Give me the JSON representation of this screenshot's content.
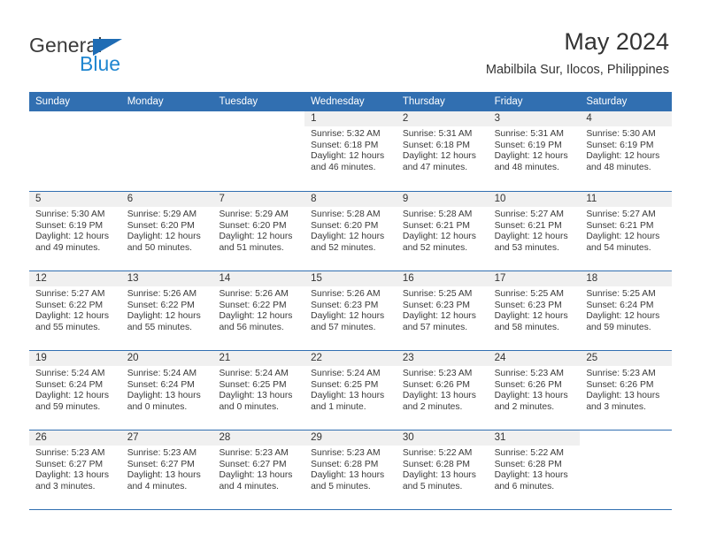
{
  "brand": {
    "name_top": "General",
    "name_bottom": "Blue",
    "accent_color": "#1f86d0",
    "triangle_color": "#1f6cb4"
  },
  "header": {
    "title": "May 2024",
    "subtitle": "Mabilbila Sur, Ilocos, Philippines"
  },
  "calendar": {
    "header_bg": "#316fb1",
    "day_band_bg": "#f0f0f0",
    "weekdays": [
      "Sunday",
      "Monday",
      "Tuesday",
      "Wednesday",
      "Thursday",
      "Friday",
      "Saturday"
    ],
    "weeks": [
      [
        {
          "day": "",
          "blank": true,
          "sunrise": "",
          "sunset": "",
          "daylight_1": "",
          "daylight_2": ""
        },
        {
          "day": "",
          "blank": true,
          "sunrise": "",
          "sunset": "",
          "daylight_1": "",
          "daylight_2": ""
        },
        {
          "day": "",
          "blank": true,
          "sunrise": "",
          "sunset": "",
          "daylight_1": "",
          "daylight_2": ""
        },
        {
          "day": "1",
          "sunrise": "Sunrise: 5:32 AM",
          "sunset": "Sunset: 6:18 PM",
          "daylight_1": "Daylight: 12 hours",
          "daylight_2": "and 46 minutes."
        },
        {
          "day": "2",
          "sunrise": "Sunrise: 5:31 AM",
          "sunset": "Sunset: 6:18 PM",
          "daylight_1": "Daylight: 12 hours",
          "daylight_2": "and 47 minutes."
        },
        {
          "day": "3",
          "sunrise": "Sunrise: 5:31 AM",
          "sunset": "Sunset: 6:19 PM",
          "daylight_1": "Daylight: 12 hours",
          "daylight_2": "and 48 minutes."
        },
        {
          "day": "4",
          "sunrise": "Sunrise: 5:30 AM",
          "sunset": "Sunset: 6:19 PM",
          "daylight_1": "Daylight: 12 hours",
          "daylight_2": "and 48 minutes."
        }
      ],
      [
        {
          "day": "5",
          "sunrise": "Sunrise: 5:30 AM",
          "sunset": "Sunset: 6:19 PM",
          "daylight_1": "Daylight: 12 hours",
          "daylight_2": "and 49 minutes."
        },
        {
          "day": "6",
          "sunrise": "Sunrise: 5:29 AM",
          "sunset": "Sunset: 6:20 PM",
          "daylight_1": "Daylight: 12 hours",
          "daylight_2": "and 50 minutes."
        },
        {
          "day": "7",
          "sunrise": "Sunrise: 5:29 AM",
          "sunset": "Sunset: 6:20 PM",
          "daylight_1": "Daylight: 12 hours",
          "daylight_2": "and 51 minutes."
        },
        {
          "day": "8",
          "sunrise": "Sunrise: 5:28 AM",
          "sunset": "Sunset: 6:20 PM",
          "daylight_1": "Daylight: 12 hours",
          "daylight_2": "and 52 minutes."
        },
        {
          "day": "9",
          "sunrise": "Sunrise: 5:28 AM",
          "sunset": "Sunset: 6:21 PM",
          "daylight_1": "Daylight: 12 hours",
          "daylight_2": "and 52 minutes."
        },
        {
          "day": "10",
          "sunrise": "Sunrise: 5:27 AM",
          "sunset": "Sunset: 6:21 PM",
          "daylight_1": "Daylight: 12 hours",
          "daylight_2": "and 53 minutes."
        },
        {
          "day": "11",
          "sunrise": "Sunrise: 5:27 AM",
          "sunset": "Sunset: 6:21 PM",
          "daylight_1": "Daylight: 12 hours",
          "daylight_2": "and 54 minutes."
        }
      ],
      [
        {
          "day": "12",
          "sunrise": "Sunrise: 5:27 AM",
          "sunset": "Sunset: 6:22 PM",
          "daylight_1": "Daylight: 12 hours",
          "daylight_2": "and 55 minutes."
        },
        {
          "day": "13",
          "sunrise": "Sunrise: 5:26 AM",
          "sunset": "Sunset: 6:22 PM",
          "daylight_1": "Daylight: 12 hours",
          "daylight_2": "and 55 minutes."
        },
        {
          "day": "14",
          "sunrise": "Sunrise: 5:26 AM",
          "sunset": "Sunset: 6:22 PM",
          "daylight_1": "Daylight: 12 hours",
          "daylight_2": "and 56 minutes."
        },
        {
          "day": "15",
          "sunrise": "Sunrise: 5:26 AM",
          "sunset": "Sunset: 6:23 PM",
          "daylight_1": "Daylight: 12 hours",
          "daylight_2": "and 57 minutes."
        },
        {
          "day": "16",
          "sunrise": "Sunrise: 5:25 AM",
          "sunset": "Sunset: 6:23 PM",
          "daylight_1": "Daylight: 12 hours",
          "daylight_2": "and 57 minutes."
        },
        {
          "day": "17",
          "sunrise": "Sunrise: 5:25 AM",
          "sunset": "Sunset: 6:23 PM",
          "daylight_1": "Daylight: 12 hours",
          "daylight_2": "and 58 minutes."
        },
        {
          "day": "18",
          "sunrise": "Sunrise: 5:25 AM",
          "sunset": "Sunset: 6:24 PM",
          "daylight_1": "Daylight: 12 hours",
          "daylight_2": "and 59 minutes."
        }
      ],
      [
        {
          "day": "19",
          "sunrise": "Sunrise: 5:24 AM",
          "sunset": "Sunset: 6:24 PM",
          "daylight_1": "Daylight: 12 hours",
          "daylight_2": "and 59 minutes."
        },
        {
          "day": "20",
          "sunrise": "Sunrise: 5:24 AM",
          "sunset": "Sunset: 6:24 PM",
          "daylight_1": "Daylight: 13 hours",
          "daylight_2": "and 0 minutes."
        },
        {
          "day": "21",
          "sunrise": "Sunrise: 5:24 AM",
          "sunset": "Sunset: 6:25 PM",
          "daylight_1": "Daylight: 13 hours",
          "daylight_2": "and 0 minutes."
        },
        {
          "day": "22",
          "sunrise": "Sunrise: 5:24 AM",
          "sunset": "Sunset: 6:25 PM",
          "daylight_1": "Daylight: 13 hours",
          "daylight_2": "and 1 minute."
        },
        {
          "day": "23",
          "sunrise": "Sunrise: 5:23 AM",
          "sunset": "Sunset: 6:26 PM",
          "daylight_1": "Daylight: 13 hours",
          "daylight_2": "and 2 minutes."
        },
        {
          "day": "24",
          "sunrise": "Sunrise: 5:23 AM",
          "sunset": "Sunset: 6:26 PM",
          "daylight_1": "Daylight: 13 hours",
          "daylight_2": "and 2 minutes."
        },
        {
          "day": "25",
          "sunrise": "Sunrise: 5:23 AM",
          "sunset": "Sunset: 6:26 PM",
          "daylight_1": "Daylight: 13 hours",
          "daylight_2": "and 3 minutes."
        }
      ],
      [
        {
          "day": "26",
          "sunrise": "Sunrise: 5:23 AM",
          "sunset": "Sunset: 6:27 PM",
          "daylight_1": "Daylight: 13 hours",
          "daylight_2": "and 3 minutes."
        },
        {
          "day": "27",
          "sunrise": "Sunrise: 5:23 AM",
          "sunset": "Sunset: 6:27 PM",
          "daylight_1": "Daylight: 13 hours",
          "daylight_2": "and 4 minutes."
        },
        {
          "day": "28",
          "sunrise": "Sunrise: 5:23 AM",
          "sunset": "Sunset: 6:27 PM",
          "daylight_1": "Daylight: 13 hours",
          "daylight_2": "and 4 minutes."
        },
        {
          "day": "29",
          "sunrise": "Sunrise: 5:23 AM",
          "sunset": "Sunset: 6:28 PM",
          "daylight_1": "Daylight: 13 hours",
          "daylight_2": "and 5 minutes."
        },
        {
          "day": "30",
          "sunrise": "Sunrise: 5:22 AM",
          "sunset": "Sunset: 6:28 PM",
          "daylight_1": "Daylight: 13 hours",
          "daylight_2": "and 5 minutes."
        },
        {
          "day": "31",
          "sunrise": "Sunrise: 5:22 AM",
          "sunset": "Sunset: 6:28 PM",
          "daylight_1": "Daylight: 13 hours",
          "daylight_2": "and 6 minutes."
        },
        {
          "day": "",
          "blank": true,
          "sunrise": "",
          "sunset": "",
          "daylight_1": "",
          "daylight_2": ""
        }
      ]
    ]
  }
}
